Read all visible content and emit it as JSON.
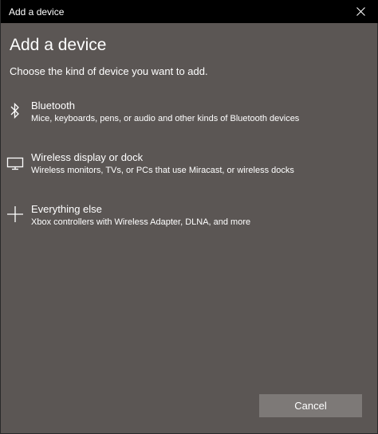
{
  "window": {
    "title": "Add a device"
  },
  "page": {
    "heading": "Add a device",
    "subheading": "Choose the kind of device you want to add."
  },
  "options": [
    {
      "icon": "bluetooth-icon",
      "name": "Bluetooth",
      "description": "Mice, keyboards, pens, or audio and other kinds of Bluetooth devices"
    },
    {
      "icon": "monitor-icon",
      "name": "Wireless display or dock",
      "description": "Wireless monitors, TVs, or PCs that use Miracast, or wireless docks"
    },
    {
      "icon": "plus-icon",
      "name": "Everything else",
      "description": "Xbox controllers with Wireless Adapter, DLNA, and more"
    }
  ],
  "footer": {
    "cancel_label": "Cancel"
  },
  "colors": {
    "titlebar": "#000000",
    "background": "#5b5654",
    "button": "#7d7977",
    "text": "#ffffff"
  }
}
